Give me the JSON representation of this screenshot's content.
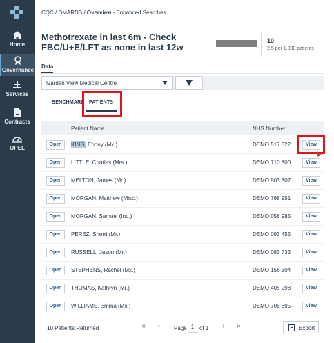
{
  "sidebar": {
    "items": [
      {
        "label": "Home",
        "icon": "home-icon"
      },
      {
        "label": "Governance",
        "icon": "award-icon",
        "active": true
      },
      {
        "label": "Services",
        "icon": "services-icon"
      },
      {
        "label": "Contracts",
        "icon": "document-icon"
      },
      {
        "label": "OPEL",
        "icon": "gauge-icon"
      }
    ]
  },
  "breadcrumb": {
    "root": "CQC / DMARDS / ",
    "current": "Overview",
    "suffix": " - Enhanced Searches"
  },
  "header": {
    "title": "Methotrexate in last 6m - Check FBC/U+E/LFT as none in last 12w",
    "stat_value": "10",
    "stat_rate": "2.5 per 1,000 patients"
  },
  "data_tab": "Data",
  "filter": {
    "practice": "Garden View Medical Centre"
  },
  "tabs": {
    "benchmark": "BENCHMARK",
    "patients": "PATIENTS"
  },
  "table": {
    "columns": [
      "Patient Name",
      "NHS Number"
    ],
    "open_label": "Open",
    "view_label": "View",
    "rows": [
      {
        "name_first": "KING,",
        "name_rest": " Ebony (Mx.)",
        "nhs": "DEMO 517 322"
      },
      {
        "name_first": "",
        "name_rest": "LITTLE, Charles (Mrs.)",
        "nhs": "DEMO 710 800"
      },
      {
        "name_first": "",
        "name_rest": "MELTON, James (Mr.)",
        "nhs": "DEMO 903 807"
      },
      {
        "name_first": "",
        "name_rest": "MORGAN, Matthew (Misc.)",
        "nhs": "DEMO 768 951"
      },
      {
        "name_first": "",
        "name_rest": "MORGAN, Samuel (Ind.)",
        "nhs": "DEMO 058 985"
      },
      {
        "name_first": "",
        "name_rest": "PEREZ, Sherri (Mr.)",
        "nhs": "DEMO 093 455"
      },
      {
        "name_first": "",
        "name_rest": "RUSSELL, Jason (Mr.)",
        "nhs": "DEMO 083 732"
      },
      {
        "name_first": "",
        "name_rest": "STEPHENS, Rachel (Mx.)",
        "nhs": "DEMO 156 304"
      },
      {
        "name_first": "",
        "name_rest": "THOMAS, Kathryn (Mr.)",
        "nhs": "DEMO 405 298"
      },
      {
        "name_first": "",
        "name_rest": "WILLIAMS, Emma (Mx.)",
        "nhs": "DEMO 708 895"
      }
    ]
  },
  "footer": {
    "returned": "10 Patients Returned",
    "page_label": "Page",
    "page_value": "1",
    "page_of": "of 1",
    "first": "«",
    "prev": "‹",
    "next": "›",
    "last": "»",
    "export": "Export"
  },
  "colors": {
    "sidebar": "#2b3b4c",
    "highlight": "#e0141c",
    "link": "#1e5a8c"
  }
}
